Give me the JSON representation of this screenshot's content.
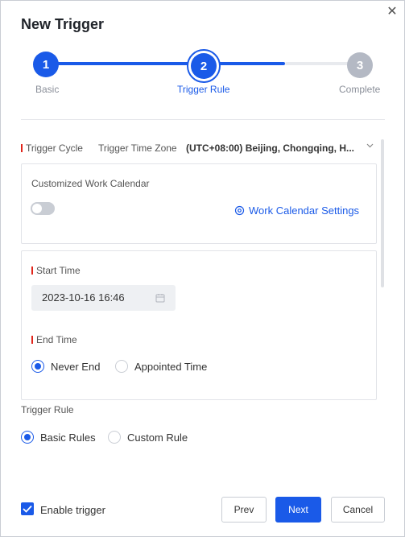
{
  "dialog": {
    "title": "New Trigger",
    "close_icon": "close-icon"
  },
  "steps": [
    {
      "number": "1",
      "label": "Basic",
      "state": "done"
    },
    {
      "number": "2",
      "label": "Trigger Rule",
      "state": "active"
    },
    {
      "number": "3",
      "label": "Complete",
      "state": "pending"
    }
  ],
  "trigger_cycle": {
    "label": "Trigger Cycle",
    "timezone_label": "Trigger Time Zone",
    "timezone_value": "(UTC+08:00) Beijing, Chongqing, H...",
    "chevron_icon": "chevron-down-icon"
  },
  "work_calendar": {
    "label": "Customized Work Calendar",
    "enabled": false,
    "settings_link": "Work Calendar Settings",
    "settings_icon": "gear-icon"
  },
  "start_time": {
    "label": "Start Time",
    "value": "2023-10-16 16:46",
    "icon": "calendar-icon"
  },
  "end_time": {
    "label": "End Time",
    "options": [
      "Never End",
      "Appointed Time"
    ],
    "selected": "Never End"
  },
  "trigger_rule": {
    "label": "Trigger Rule",
    "options": [
      "Basic Rules",
      "Custom Rule"
    ],
    "selected": "Basic Rules"
  },
  "footer": {
    "enable_label": "Enable trigger",
    "enabled": true,
    "prev_label": "Prev",
    "next_label": "Next",
    "cancel_label": "Cancel"
  },
  "colors": {
    "primary": "#1a5ae8",
    "required": "#e1251b",
    "inactive_step": "#b4b9c4"
  }
}
